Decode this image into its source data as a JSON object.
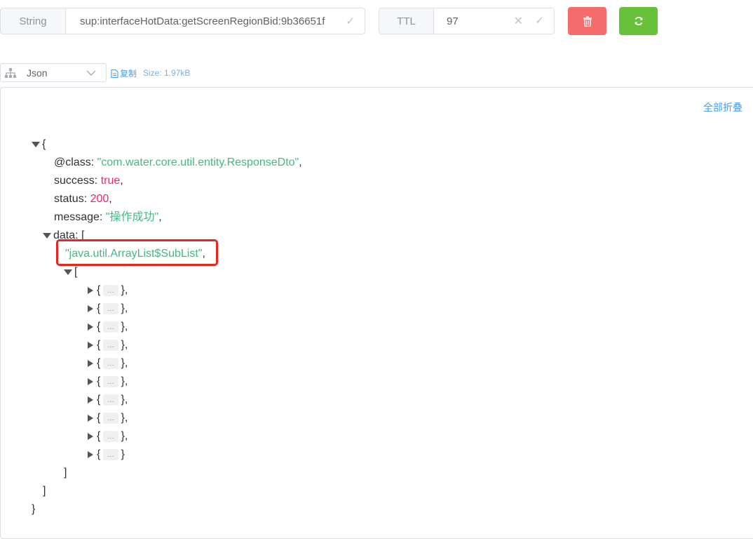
{
  "toolbar": {
    "type_label": "String",
    "key_value": "sup:interfaceHotData:getScreenRegionBid:9b36651f",
    "ttl_label": "TTL",
    "ttl_value": "97"
  },
  "format": {
    "selected": "Json",
    "copy_label": "复制",
    "size_text": "Size: 1.97kB"
  },
  "viewer": {
    "collapse_all_label": "全部折叠",
    "json": {
      "open_brace": "{",
      "class_key": "@class",
      "class_value": "\"com.water.core.util.entity.ResponseDto\"",
      "success_key": "success",
      "success_value": "true",
      "status_key": "status",
      "status_value": "200",
      "message_key": "message",
      "message_value": "\"操作成功\"",
      "data_key": "data",
      "data_open": "[",
      "sublist_value": "\"java.util.ArrayList$SubList\"",
      "inner_open": "[",
      "collapsed_placeholder": "...",
      "collapsed_item_count": 10,
      "inner_close": "]",
      "data_close": "]",
      "close_brace": "}"
    }
  },
  "colors": {
    "string": "#42b983",
    "keyword": "#fc1e70",
    "link": "#409eff",
    "danger": "#f56c6c",
    "success": "#67c23a",
    "highlight": "#e8251e"
  }
}
